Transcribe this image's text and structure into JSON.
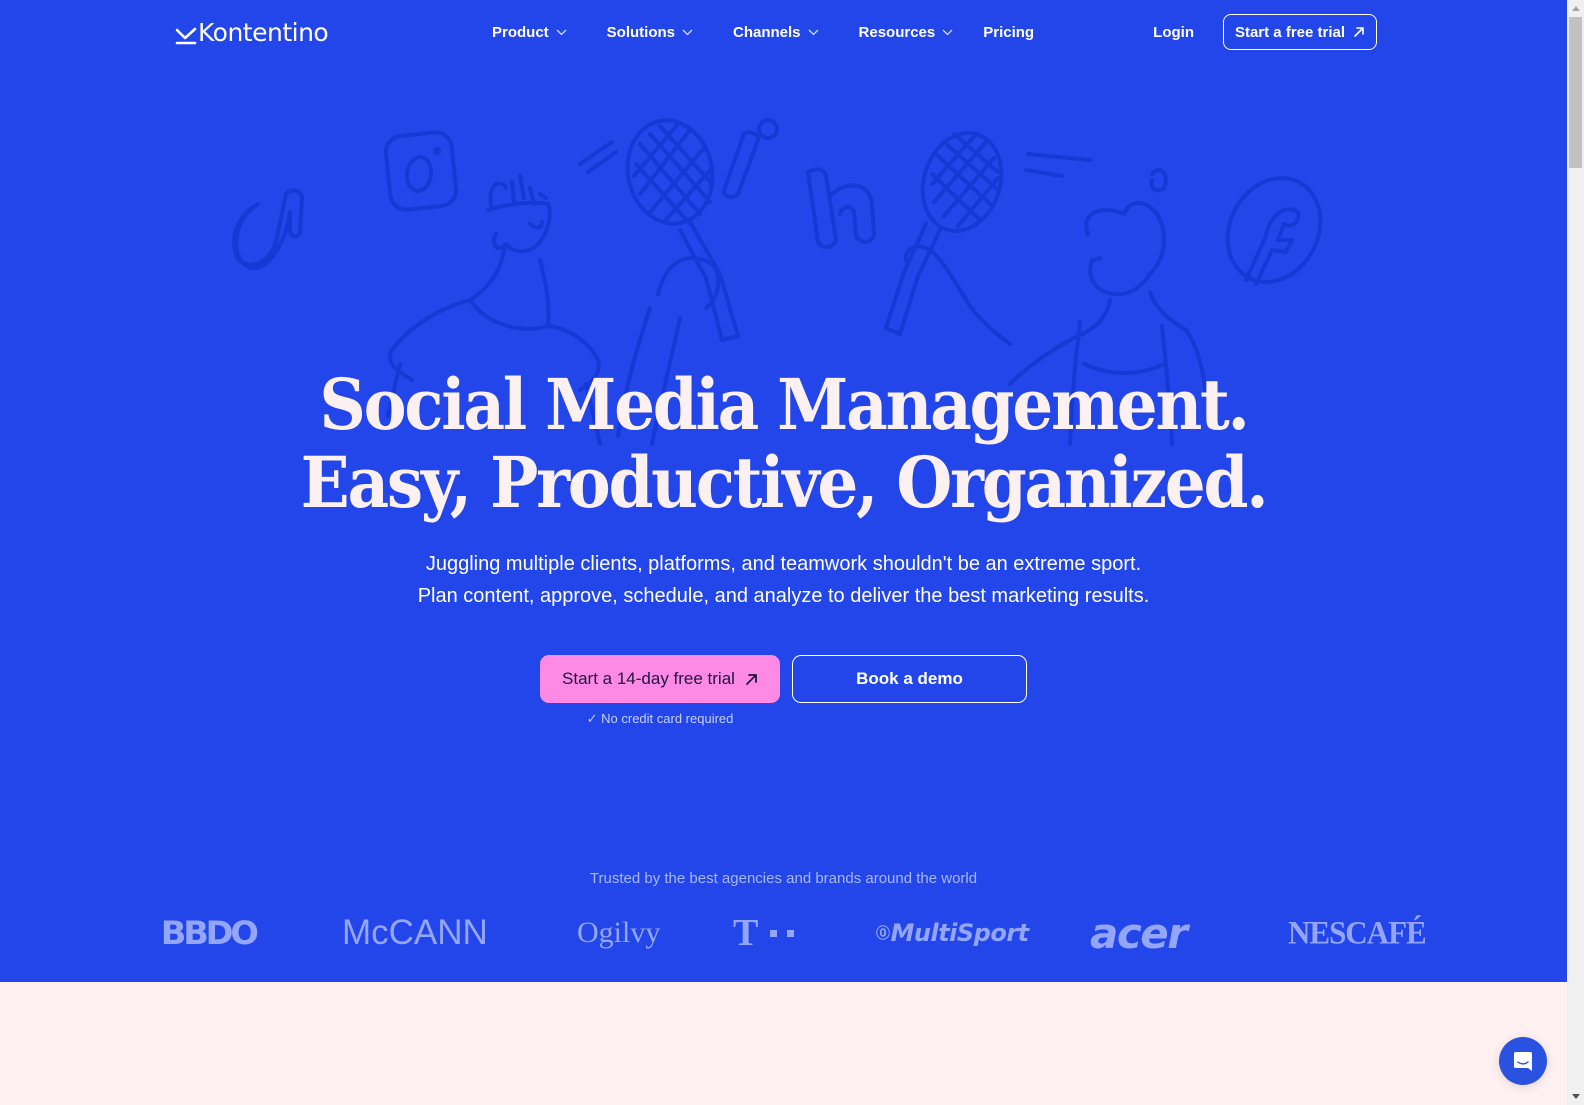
{
  "brand": {
    "name": "Kontentino",
    "logo_icon": "kontentino-check-mark-icon"
  },
  "nav": {
    "items": [
      {
        "label": "Product",
        "has_dropdown": true
      },
      {
        "label": "Solutions",
        "has_dropdown": true
      },
      {
        "label": "Channels",
        "has_dropdown": true
      },
      {
        "label": "Resources",
        "has_dropdown": true
      },
      {
        "label": "Pricing",
        "has_dropdown": false
      }
    ],
    "login_label": "Login",
    "cta_label": "Start a free trial",
    "cta_icon": "arrow-up-right-icon"
  },
  "hero": {
    "illustration_icons": [
      "tiktok-icon",
      "instagram-icon",
      "linkedin-icon",
      "facebook-icon",
      "tennis-racket-icon"
    ],
    "headline_line1": "Social Media Management.",
    "headline_line2": "Easy, Productive, Organized.",
    "subtitle_line1": "Juggling multiple clients, platforms, and teamwork shouldn't be an extreme sport.",
    "subtitle_line2": "Plan content, approve, schedule, and analyze to deliver the best marketing results.",
    "primary_cta": "Start a 14-day free trial",
    "secondary_cta": "Book a demo",
    "no_credit_card": "No credit card required",
    "check_icon": "✓"
  },
  "trusted": {
    "label": "Trusted by the best agencies and brands around the world",
    "logos": [
      "BBDO",
      "McCANN",
      "Ogilvy",
      "T",
      "MultiSport",
      "acer",
      "NESCAFÉ"
    ]
  },
  "colors": {
    "hero_bg": "#2346ea",
    "illustration_stroke": "#1638d4",
    "headline": "#fdf0f1",
    "primary_cta_bg": "#ff8ae6",
    "logo_tint": "#93a6fb",
    "below_fold_bg": "#fff0f1",
    "chat_button": "#2852df"
  },
  "chat": {
    "icon": "chat-bubble-icon"
  }
}
